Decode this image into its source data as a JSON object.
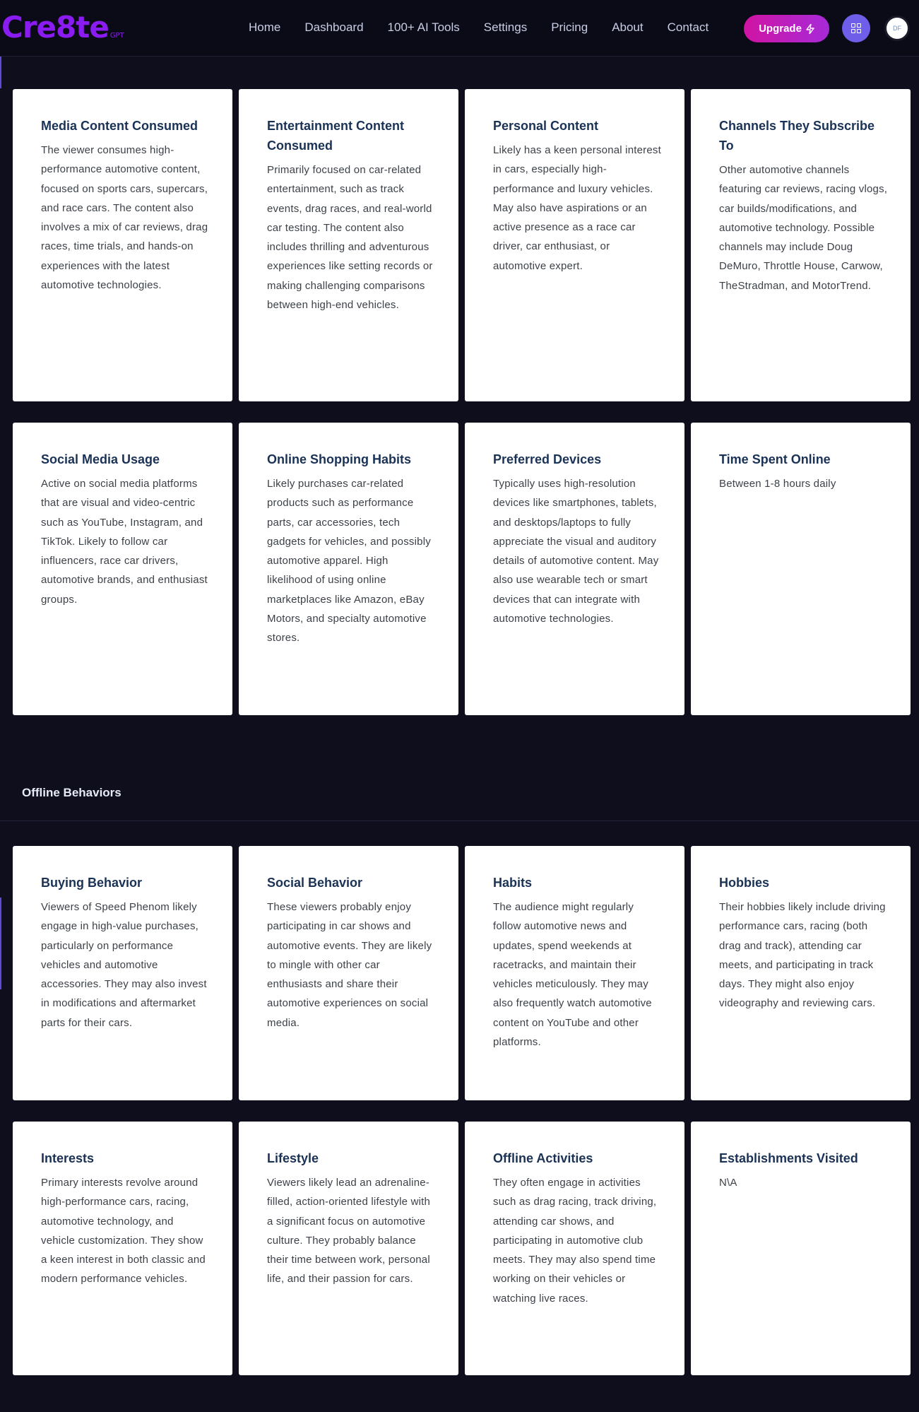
{
  "nav": {
    "logo": "Cre8te",
    "logo_suffix": "GPT",
    "links": [
      "Home",
      "Dashboard",
      "100+ AI Tools",
      "Settings",
      "Pricing",
      "About",
      "Contact"
    ],
    "upgrade_label": "Upgrade",
    "upgrade_icon": "lightning-icon",
    "grid_icon": "apps-grid-icon",
    "avatar_initials": "DF"
  },
  "online_cards": [
    {
      "title": "Media Content Consumed",
      "body": "The viewer consumes high-performance automotive content, focused on sports cars, supercars, and race cars. The content also involves a mix of car reviews, drag races, time trials, and hands-on experiences with the latest automotive technologies."
    },
    {
      "title": "Entertainment Content Consumed",
      "body": "Primarily focused on car-related entertainment, such as track events, drag races, and real-world car testing. The content also includes thrilling and adventurous experiences like setting records or making challenging comparisons between high-end vehicles."
    },
    {
      "title": "Personal Content",
      "body": "Likely has a keen personal interest in cars, especially high-performance and luxury vehicles. May also have aspirations or an active presence as a race car driver, car enthusiast, or automotive expert."
    },
    {
      "title": "Channels They Subscribe To",
      "body": "Other automotive channels featuring car reviews, racing vlogs, car builds/modifications, and automotive technology. Possible channels may include Doug DeMuro, Throttle House, Carwow, TheStradman, and MotorTrend."
    },
    {
      "title": "Social Media Usage",
      "body": "Active on social media platforms that are visual and video-centric such as YouTube, Instagram, and TikTok. Likely to follow car influencers, race car drivers, automotive brands, and enthusiast groups."
    },
    {
      "title": "Online Shopping Habits",
      "body": "Likely purchases car-related products such as performance parts, car accessories, tech gadgets for vehicles, and possibly automotive apparel. High likelihood of using online marketplaces like Amazon, eBay Motors, and specialty automotive stores."
    },
    {
      "title": "Preferred Devices",
      "body": "Typically uses high-resolution devices like smartphones, tablets, and desktops/laptops to fully appreciate the visual and auditory details of automotive content. May also use wearable tech or smart devices that can integrate with automotive technologies."
    },
    {
      "title": "Time Spent Online",
      "body": "Between 1-8 hours daily"
    }
  ],
  "offline_section": {
    "heading": "Offline Behaviors"
  },
  "offline_cards": [
    {
      "title": "Buying Behavior",
      "body": "Viewers of Speed Phenom likely engage in high-value purchases, particularly on performance vehicles and automotive accessories. They may also invest in modifications and aftermarket parts for their cars."
    },
    {
      "title": "Social Behavior",
      "body": "These viewers probably enjoy participating in car shows and automotive events. They are likely to mingle with other car enthusiasts and share their automotive experiences on social media."
    },
    {
      "title": "Habits",
      "body": "The audience might regularly follow automotive news and updates, spend weekends at racetracks, and maintain their vehicles meticulously. They may also frequently watch automotive content on YouTube and other platforms."
    },
    {
      "title": "Hobbies",
      "body": "Their hobbies likely include driving performance cars, racing (both drag and track), attending car meets, and participating in track days. They might also enjoy videography and reviewing cars."
    },
    {
      "title": "Interests",
      "body": "Primary interests revolve around high-performance cars, racing, automotive technology, and vehicle customization. They show a keen interest in both classic and modern performance vehicles."
    },
    {
      "title": "Lifestyle",
      "body": "Viewers likely lead an adrenaline-filled, action-oriented lifestyle with a significant focus on automotive culture. They probably balance their time between work, personal life, and their passion for cars."
    },
    {
      "title": "Offline Activities",
      "body": "They often engage in activities such as drag racing, track driving, attending car shows, and participating in automotive club meets. They may also spend time working on their vehicles or watching live races."
    },
    {
      "title": "Establishments Visited",
      "body": "N\\A"
    }
  ]
}
